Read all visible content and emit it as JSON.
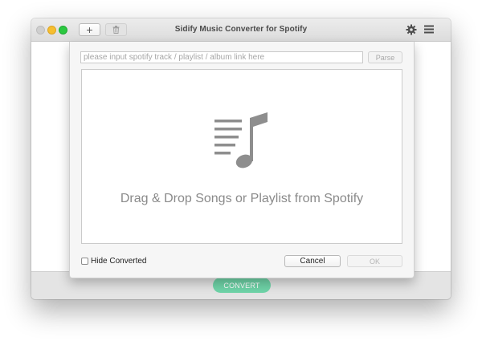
{
  "window": {
    "title": "Sidify Music Converter for Spotify"
  },
  "toolbar": {
    "add_label": "+",
    "add_icon": "plus-icon",
    "delete_icon": "trash-icon",
    "settings_icon": "gear-icon",
    "menu_icon": "hamburger-menu-icon"
  },
  "footer": {
    "convert_label": "CONVERT",
    "convert_color": "#6fd4a8"
  },
  "dialog": {
    "link_input": {
      "value": "",
      "placeholder": "please input spotify track / playlist / album link here"
    },
    "parse_label": "Parse",
    "drop_icon": "music-playlist-icon",
    "drop_text": "Drag & Drop Songs or Playlist from Spotify",
    "hide_converted_label": "Hide Converted",
    "hide_converted_checked": false,
    "cancel_label": "Cancel",
    "ok_label": "OK"
  },
  "colors": {
    "traffic_close": "#cfcfcf",
    "traffic_minimize": "#f6be2f",
    "traffic_maximize": "#2bc840",
    "icon_gray": "#8e8e8e"
  }
}
